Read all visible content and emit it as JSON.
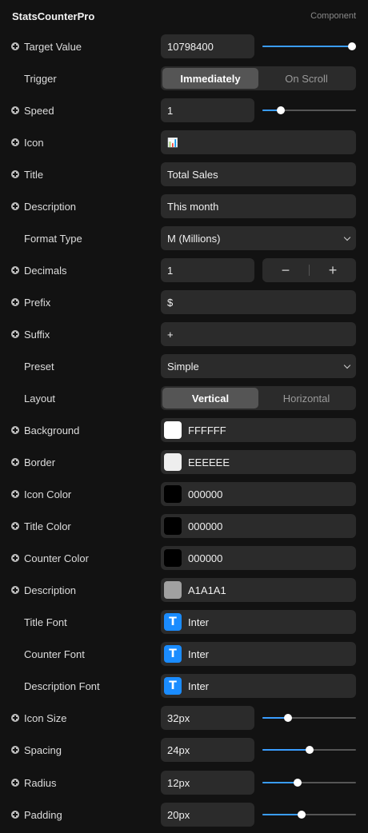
{
  "header": {
    "title": "StatsCounterPro",
    "tag": "Component"
  },
  "rows": {
    "target_value": {
      "label": "Target Value",
      "value": "10798400",
      "slider": 1.0
    },
    "trigger": {
      "label": "Trigger",
      "options": [
        "Immediately",
        "On Scroll"
      ],
      "selected": "Immediately"
    },
    "speed": {
      "label": "Speed",
      "value": "1",
      "slider": 0.2
    },
    "icon": {
      "label": "Icon",
      "value": "📊"
    },
    "title": {
      "label": "Title",
      "value": "Total Sales"
    },
    "description": {
      "label": "Description",
      "value": "This month"
    },
    "format_type": {
      "label": "Format Type",
      "value": "M (Millions)"
    },
    "decimals": {
      "label": "Decimals",
      "value": "1",
      "minus": "−",
      "plus": "+"
    },
    "prefix": {
      "label": "Prefix",
      "value": "$"
    },
    "suffix": {
      "label": "Suffix",
      "value": "+"
    },
    "preset": {
      "label": "Preset",
      "value": "Simple"
    },
    "layout": {
      "label": "Layout",
      "options": [
        "Vertical",
        "Horizontal"
      ],
      "selected": "Vertical"
    },
    "background": {
      "label": "Background",
      "value": "FFFFFF",
      "color": "#FFFFFF"
    },
    "border": {
      "label": "Border",
      "value": "EEEEEE",
      "color": "#EEEEEE"
    },
    "icon_color": {
      "label": "Icon Color",
      "value": "000000",
      "color": "#000000"
    },
    "title_color": {
      "label": "Title Color",
      "value": "000000",
      "color": "#000000"
    },
    "counter_color": {
      "label": "Counter Color",
      "value": "000000",
      "color": "#000000"
    },
    "description_color": {
      "label": "Description",
      "value": "A1A1A1",
      "color": "#A1A1A1"
    },
    "title_font": {
      "label": "Title Font",
      "value": "Inter",
      "icon_glyph": "T"
    },
    "counter_font": {
      "label": "Counter Font",
      "value": "Inter",
      "icon_glyph": "T"
    },
    "description_font": {
      "label": "Description Font",
      "value": "Inter",
      "icon_glyph": "T"
    },
    "icon_size": {
      "label": "Icon Size",
      "value": "32px",
      "slider": 0.27
    },
    "spacing": {
      "label": "Spacing",
      "value": "24px",
      "slider": 0.5
    },
    "radius": {
      "label": "Radius",
      "value": "12px",
      "slider": 0.38
    },
    "padding": {
      "label": "Padding",
      "value": "20px",
      "slider": 0.42
    }
  },
  "colors": {
    "accent": "#3A9DFF",
    "font_icon": "#1A8CFF"
  }
}
